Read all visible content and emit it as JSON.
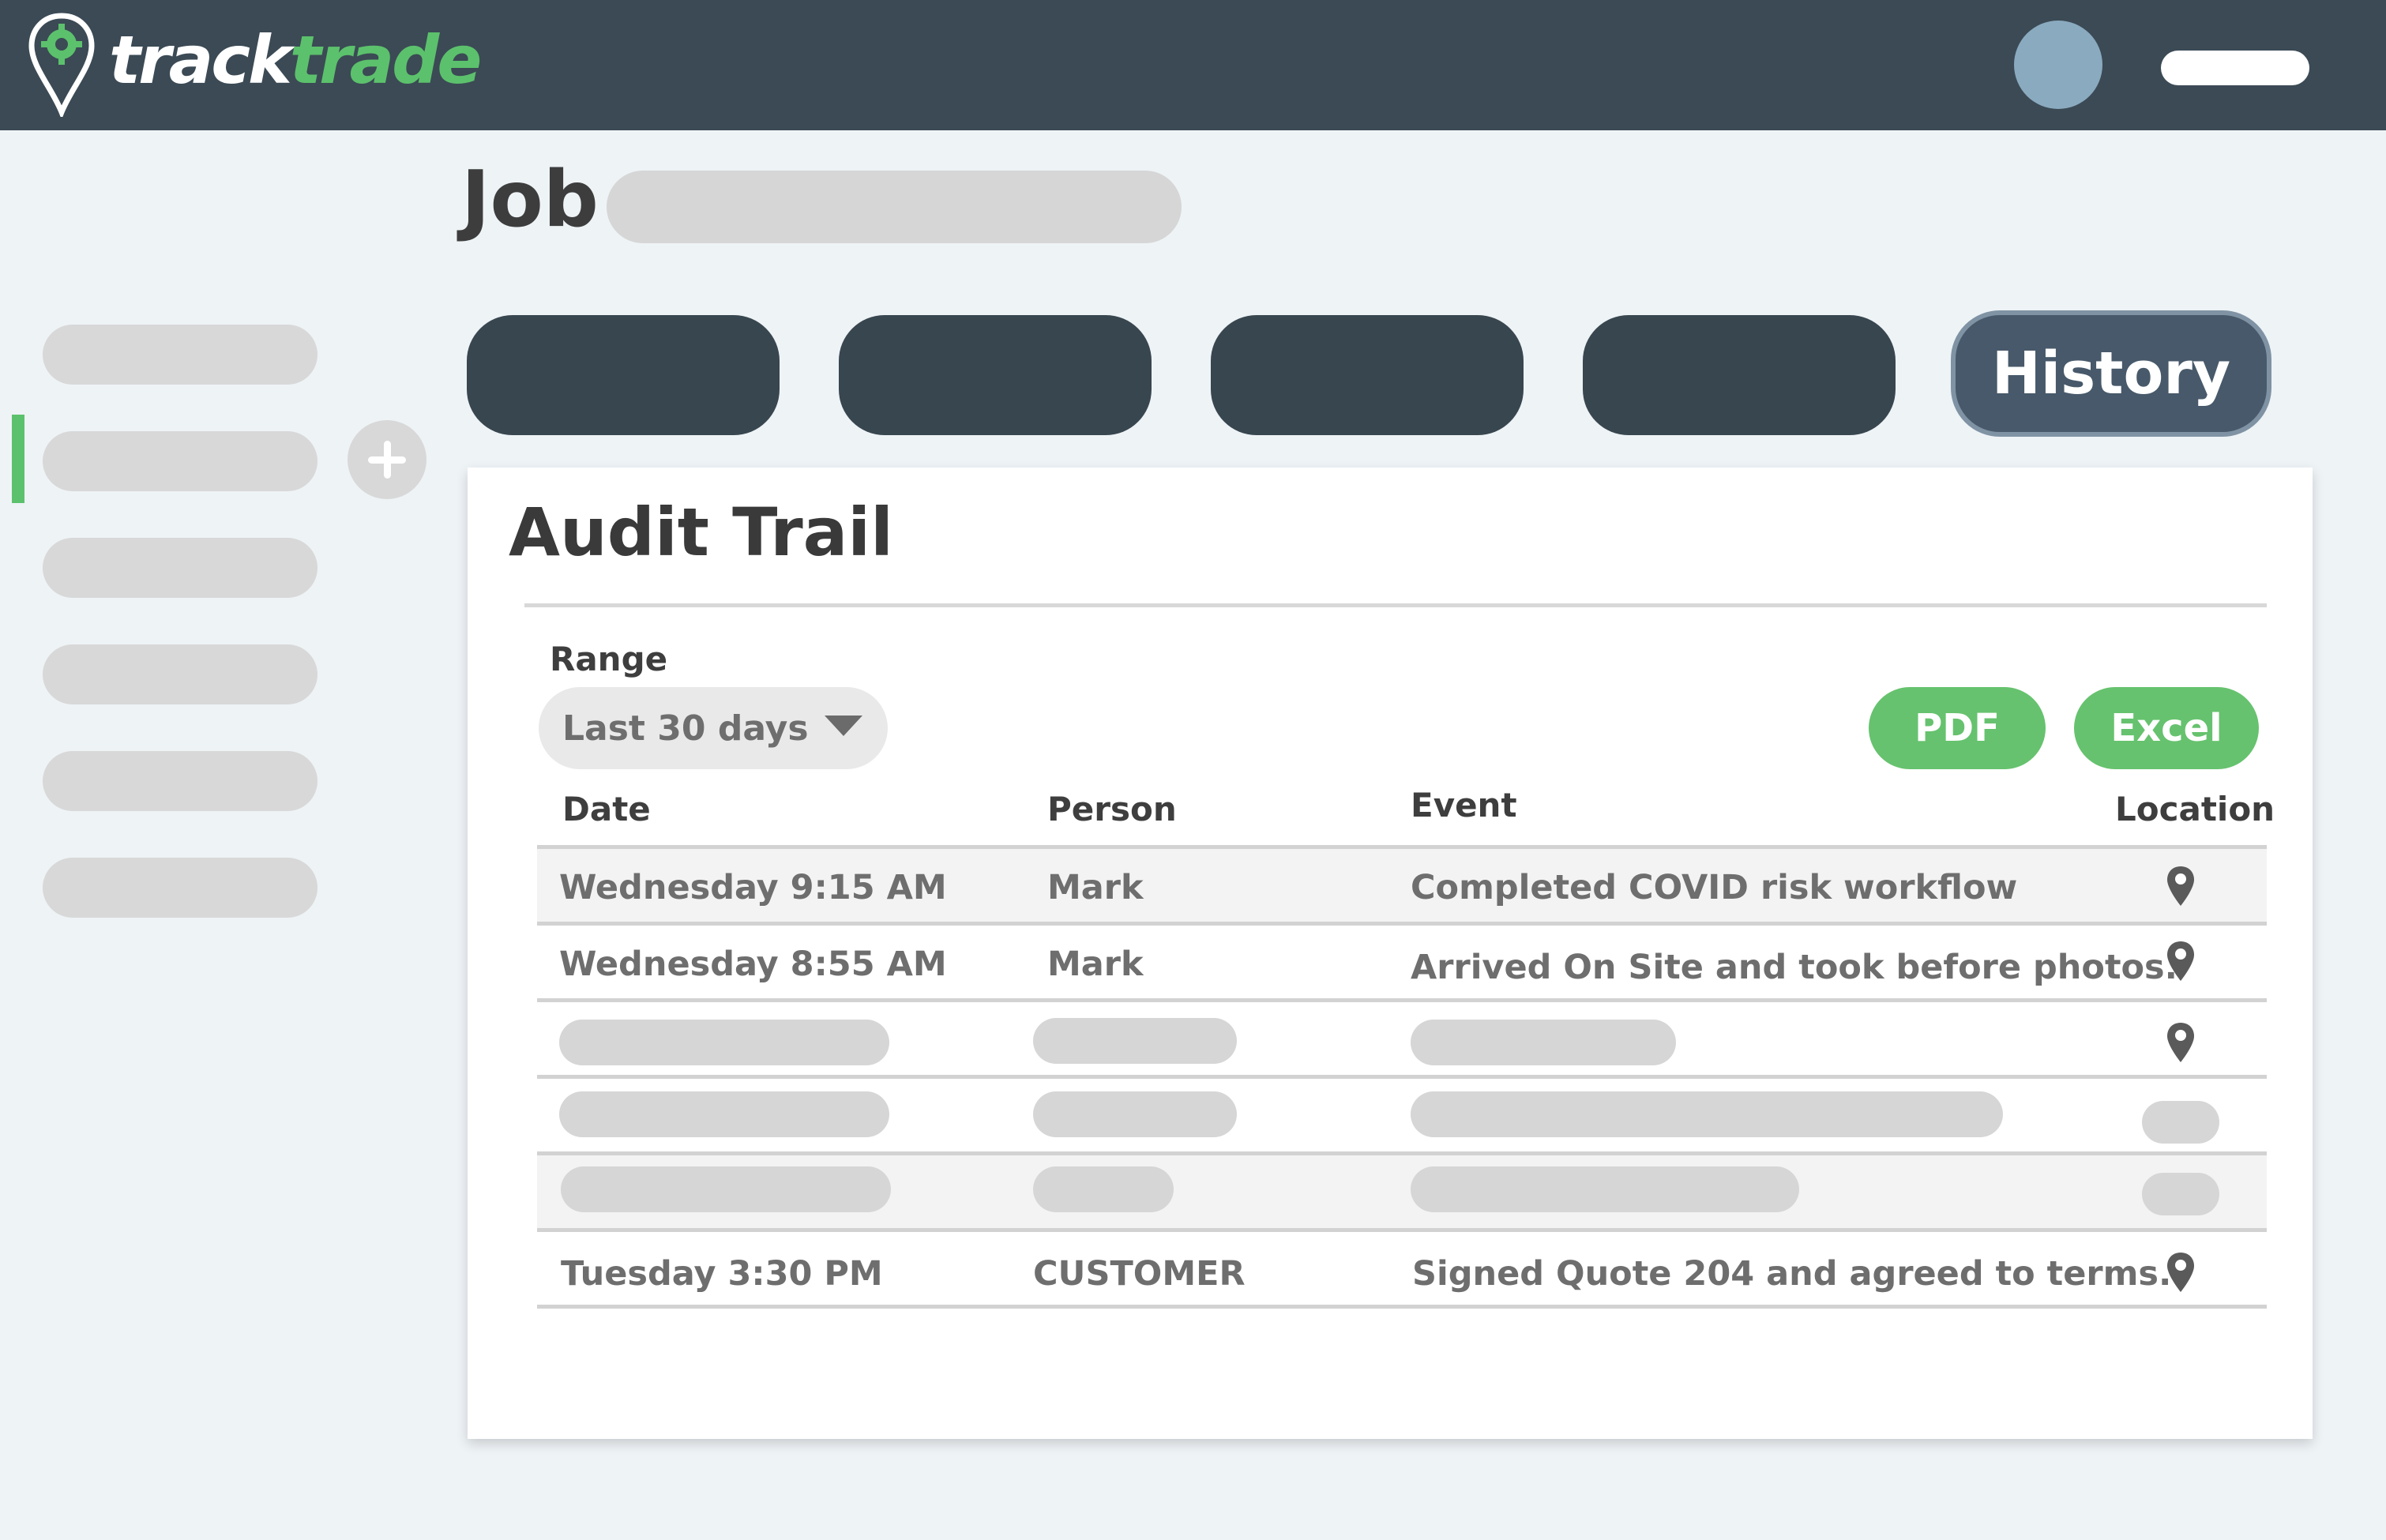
{
  "brand": {
    "name_part1": "track",
    "name_part2": "trade",
    "accent": "#5cc16c",
    "header_bg": "#3b4a55"
  },
  "header": {
    "avatar_color": "#8aaabf"
  },
  "page": {
    "title": "Job"
  },
  "tabs": {
    "history_label": "History"
  },
  "card": {
    "title": "Audit Trail",
    "range_label": "Range",
    "range_value": "Last 30 days",
    "pdf_label": "PDF",
    "excel_label": "Excel"
  },
  "table": {
    "headers": {
      "date": "Date",
      "person": "Person",
      "event": "Event",
      "location": "Location"
    },
    "rows": [
      {
        "date": "Wednesday 9:15 AM",
        "person": "Mark",
        "event": "Completed COVID risk workflow",
        "location_icon": "map-pin-icon"
      },
      {
        "date": "Wednesday 8:55 AM",
        "person": "Mark",
        "event": "Arrived On Site and took before photos.",
        "location_icon": "map-pin-icon"
      },
      {
        "date": "",
        "person": "",
        "event": "",
        "location_icon": "map-pin-icon"
      },
      {
        "date": "",
        "person": "",
        "event": "",
        "location_icon": ""
      },
      {
        "date": "",
        "person": "",
        "event": "",
        "location_icon": ""
      },
      {
        "date": "Tuesday 3:30 PM",
        "person": "CUSTOMER",
        "event": "Signed Quote 204 and agreed to terms.",
        "location_icon": "map-pin-icon"
      }
    ]
  }
}
